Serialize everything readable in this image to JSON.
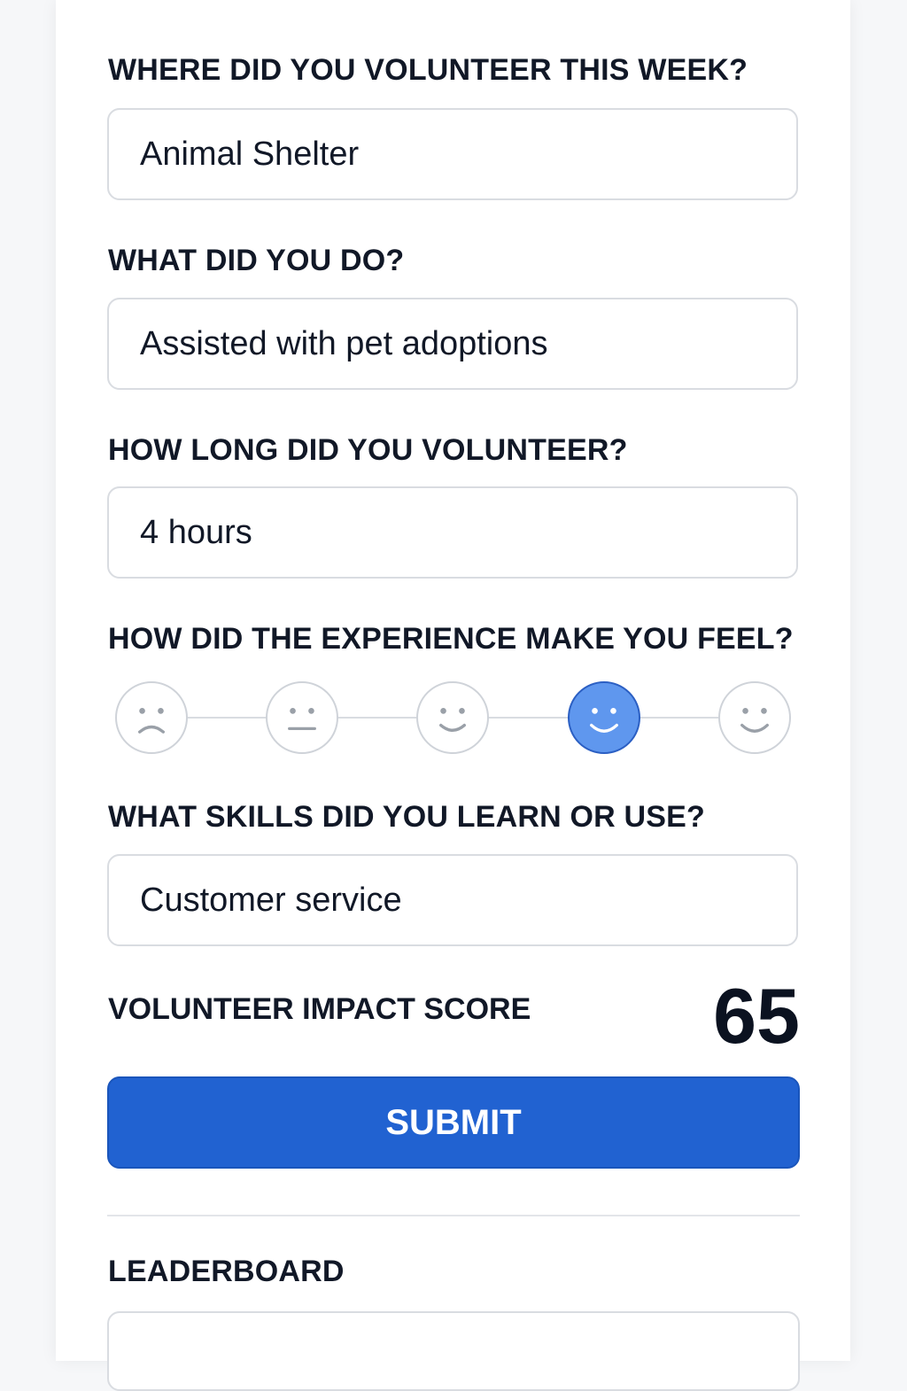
{
  "form": {
    "where": {
      "label": "WHERE DID YOU VOLUNTEER THIS WEEK?",
      "value": "Animal Shelter"
    },
    "what": {
      "label": "WHAT DID YOU DO?",
      "value": "Assisted with pet adoptions"
    },
    "duration": {
      "label": "HOW LONG DID YOU VOLUNTEER?",
      "value": "4 hours"
    },
    "feeling": {
      "label": "HOW DID THE EXPERIENCE MAKE YOU FEEL?",
      "options": [
        "sad-face-icon",
        "neutral-face-icon",
        "slight-smile-icon",
        "smile-icon",
        "happy-face-icon"
      ],
      "selected_index": 3,
      "selected_color": "#5f97ee"
    },
    "skills": {
      "label": "WHAT SKILLS DID YOU LEARN OR USE?",
      "value": "Customer service"
    },
    "score": {
      "label": "VOLUNTEER IMPACT SCORE",
      "value": "65"
    },
    "submit_label": "SUBMIT",
    "accent_color": "#2162d1"
  },
  "leaderboard": {
    "title": "LEADERBOARD"
  }
}
